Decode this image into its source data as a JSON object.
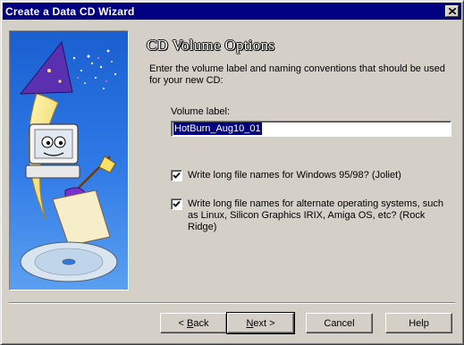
{
  "window": {
    "title": "Create a Data CD Wizard"
  },
  "heading": "CD Volume Options",
  "intro": "Enter the volume label and naming conventions that should be used for your new CD:",
  "volume": {
    "label": "Volume label:",
    "value": "HotBurn_Aug10_01"
  },
  "options": [
    {
      "label": "Write long file names for Windows 95/98? (Joliet)",
      "checked": true
    },
    {
      "label": "Write long file names for alternate operating systems, such as Linux, Silicon Graphics IRIX, Amiga OS, etc? (Rock Ridge)",
      "checked": true
    }
  ],
  "buttons": {
    "back": {
      "prefix": "< ",
      "hotkey": "B",
      "rest": "ack"
    },
    "next": {
      "hotkey": "N",
      "rest": "ext >"
    },
    "cancel": "Cancel",
    "help": "Help"
  },
  "colors": {
    "titlebar": "#000080",
    "dialog": "#d4d0c8",
    "selection": "#000080"
  },
  "icons": [
    "close-icon",
    "checkmark-icon",
    "wizard-illustration"
  ]
}
